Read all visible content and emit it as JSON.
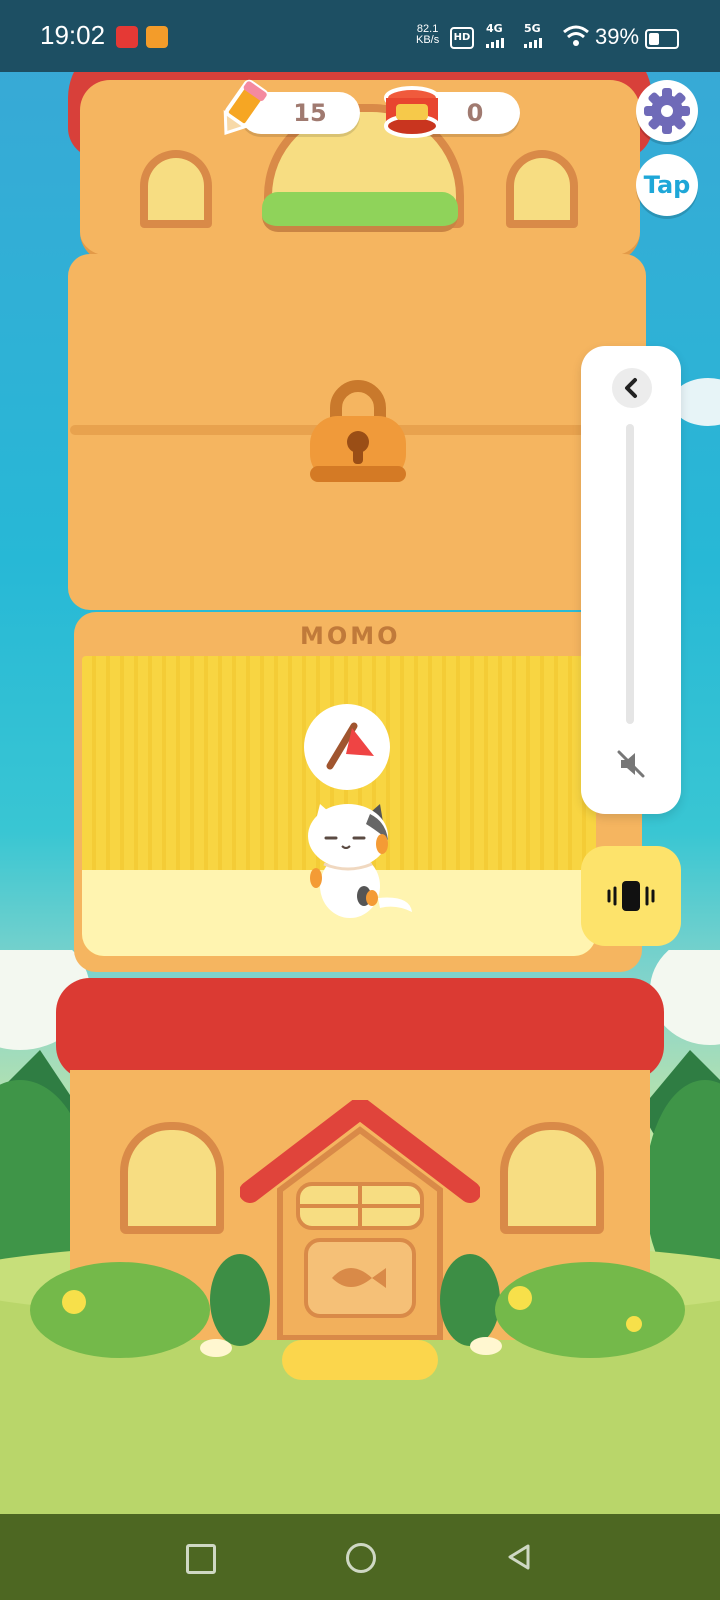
{
  "status_bar": {
    "time": "19:02",
    "net_rate_value": "82.1",
    "net_rate_unit": "KB/s",
    "hd_label": "HD",
    "sim1_label": "4G",
    "sim2_label": "5G",
    "battery_text": "39%",
    "battery_level": 0.39
  },
  "hud": {
    "pencils_count": "15",
    "cans_count": "0",
    "tap_label": "Tap"
  },
  "room": {
    "name_label": "MOMO"
  },
  "volume": {
    "level": 0
  },
  "colors": {
    "roof_red": "#db3a33",
    "wall_orange": "#f5b560",
    "room_yellow": "#f8d542",
    "vibrate_yellow": "#fde36b",
    "gear_purple": "#6f6ab8",
    "tap_blue": "#1ea7d8"
  }
}
